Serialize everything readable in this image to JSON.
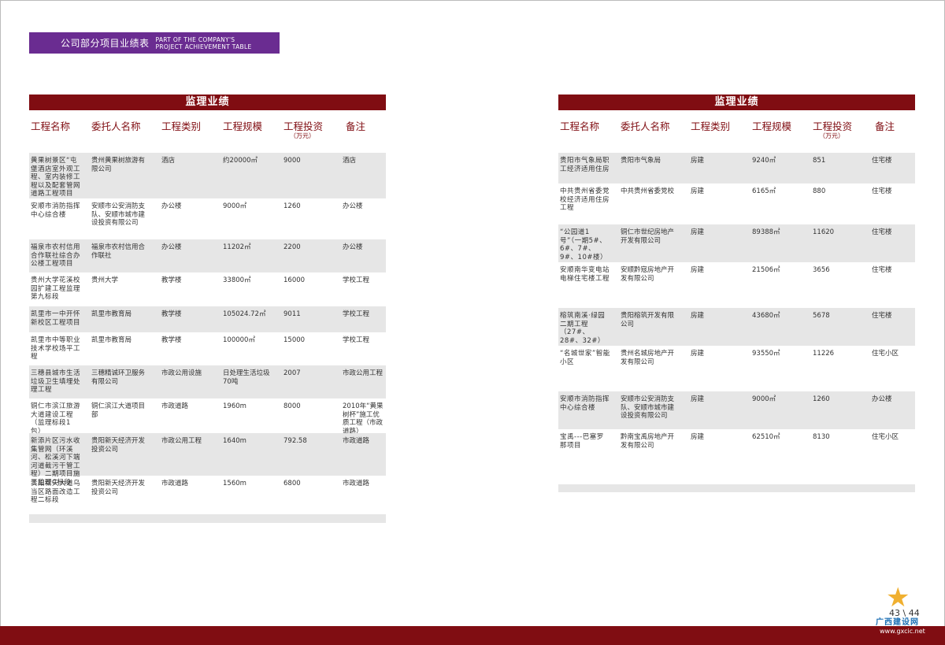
{
  "header": {
    "title_cn": "公司部分项目业绩表",
    "title_en_line1": "PART OF THE COMPANY'S",
    "title_en_line2": "PROJECT ACHIEVEMENT TABLE"
  },
  "columns": {
    "name": "工程名称",
    "client": "委托人名称",
    "category": "工程类别",
    "scale": "工程规模",
    "investment": "工程投资",
    "investment_unit": "（万元）",
    "note": "备注"
  },
  "left": {
    "title": "监理业绩",
    "rows": [
      {
        "name": "黄果树景区“屯堡酒店室外观工程、室内装修工程以及配套管网道路工程项目",
        "client": "贵州黄果树旅游有限公司",
        "category": "酒店",
        "scale": "约20000㎡",
        "investment": "9000",
        "note": "酒店"
      },
      {
        "name": "安顺市消防指挥中心综合楼",
        "client": "安顺市公安消防支队、安顺市城市建设投资有限公司",
        "category": "办公楼",
        "scale": "9000㎡",
        "investment": "1260",
        "note": "办公楼"
      },
      {
        "name": "福泉市农村信用合作联社综合办公楼工程项目",
        "client": "福泉市农村信用合作联社",
        "category": "办公楼",
        "scale": "11202㎡",
        "investment": "2200",
        "note": "办公楼"
      },
      {
        "name": "贵州大学花溪校园扩建工程监理第九标段",
        "client": "贵州大学",
        "category": "教学楼",
        "scale": "33800㎡",
        "investment": "16000",
        "note": "学校工程"
      },
      {
        "name": "凯里市一中开怀新校区工程项目",
        "client": "凯里市教育局",
        "category": "教学楼",
        "scale": "105024.72㎡",
        "investment": "9011",
        "note": "学校工程"
      },
      {
        "name": "凯里市中等职业技术学校场平工程",
        "client": "凯里市教育局",
        "category": "教学楼",
        "scale": "100000㎡",
        "investment": "15000",
        "note": "学校工程"
      },
      {
        "name": "三穗县城市生活垃圾卫生填埋处理工程",
        "client": "三穗精诚环卫服务有限公司",
        "category": "市政公用设施",
        "scale": "日处理生活垃圾70吨",
        "investment": "2007",
        "note": "市政公用工程"
      },
      {
        "name": "铜仁市滨江旅游大道建设工程（监理标段1包）",
        "client": "铜仁滨江大道项目部",
        "category": "市政道路",
        "scale": "1960m",
        "investment": "8000",
        "note": "2010年“黄果树杯”施工优质工程（市政道路）"
      },
      {
        "name": "新添片区污水收集管网（环溪河、松溪河下端河道截污干管工程）二期项目施工监理C标段",
        "client": "贵阳新天经济开发投资公司",
        "category": "市政公用工程",
        "scale": "1640m",
        "investment": "792.58",
        "note": "市政道路"
      },
      {
        "name": "贵阳新天大道乌当区路面改造工程二标段",
        "client": "贵阳新天经济开发投资公司",
        "category": "市政道路",
        "scale": "1560m",
        "investment": "6800",
        "note": "市政道路"
      }
    ]
  },
  "right": {
    "title": "监理业绩",
    "rows": [
      {
        "name": "贵阳市气象局职工经济适用住房",
        "client": "贵阳市气象局",
        "category": "房建",
        "scale": "9240㎡",
        "investment": "851",
        "note": "住宅楼"
      },
      {
        "name": "中共贵州省委党校经济适用住房工程",
        "client": "中共贵州省委党校",
        "category": "房建",
        "scale": "6165㎡",
        "investment": "880",
        "note": "住宅楼"
      },
      {
        "name": "“公园道1号”（一期5#、6#、7#、9#、10#楼）",
        "client": "铜仁市世纪房地产开发有限公司",
        "category": "房建",
        "scale": "89388㎡",
        "investment": "11620",
        "note": "住宅楼"
      },
      {
        "name": "安顺南华变电站电梯住宅楼工程",
        "client": "安顺黔寇房地产开发有限公司",
        "category": "房建",
        "scale": "21506㎡",
        "investment": "3656",
        "note": "住宅楼"
      },
      {
        "name": "榕筑南溪·绿园二期工程（27#、28#、32#）",
        "client": "贵阳榕筑开发有限公司",
        "category": "房建",
        "scale": "43680㎡",
        "investment": "5678",
        "note": "住宅楼"
      },
      {
        "name": "“名城世家”智能小区",
        "client": "贵州名城房地产开发有限公司",
        "category": "房建",
        "scale": "93550㎡",
        "investment": "11226",
        "note": "住宅小区"
      },
      {
        "name": "安顺市消防指挥中心综合楼",
        "client": "安顺市公安消防支队、安顺市城市建设投资有限公司",
        "category": "房建",
        "scale": "9000㎡",
        "investment": "1260",
        "note": "办公楼"
      },
      {
        "name": "宝禹---巴塞罗那项目",
        "client": "黔南宝禹房地产开发有限公司",
        "category": "房建",
        "scale": "62510㎡",
        "investment": "8130",
        "note": "住宅小区"
      }
    ]
  },
  "footer": {
    "page_numbers": "43 \\ 44",
    "logo_text": "广西建设网",
    "logo_url": "www.gxcic.net"
  }
}
